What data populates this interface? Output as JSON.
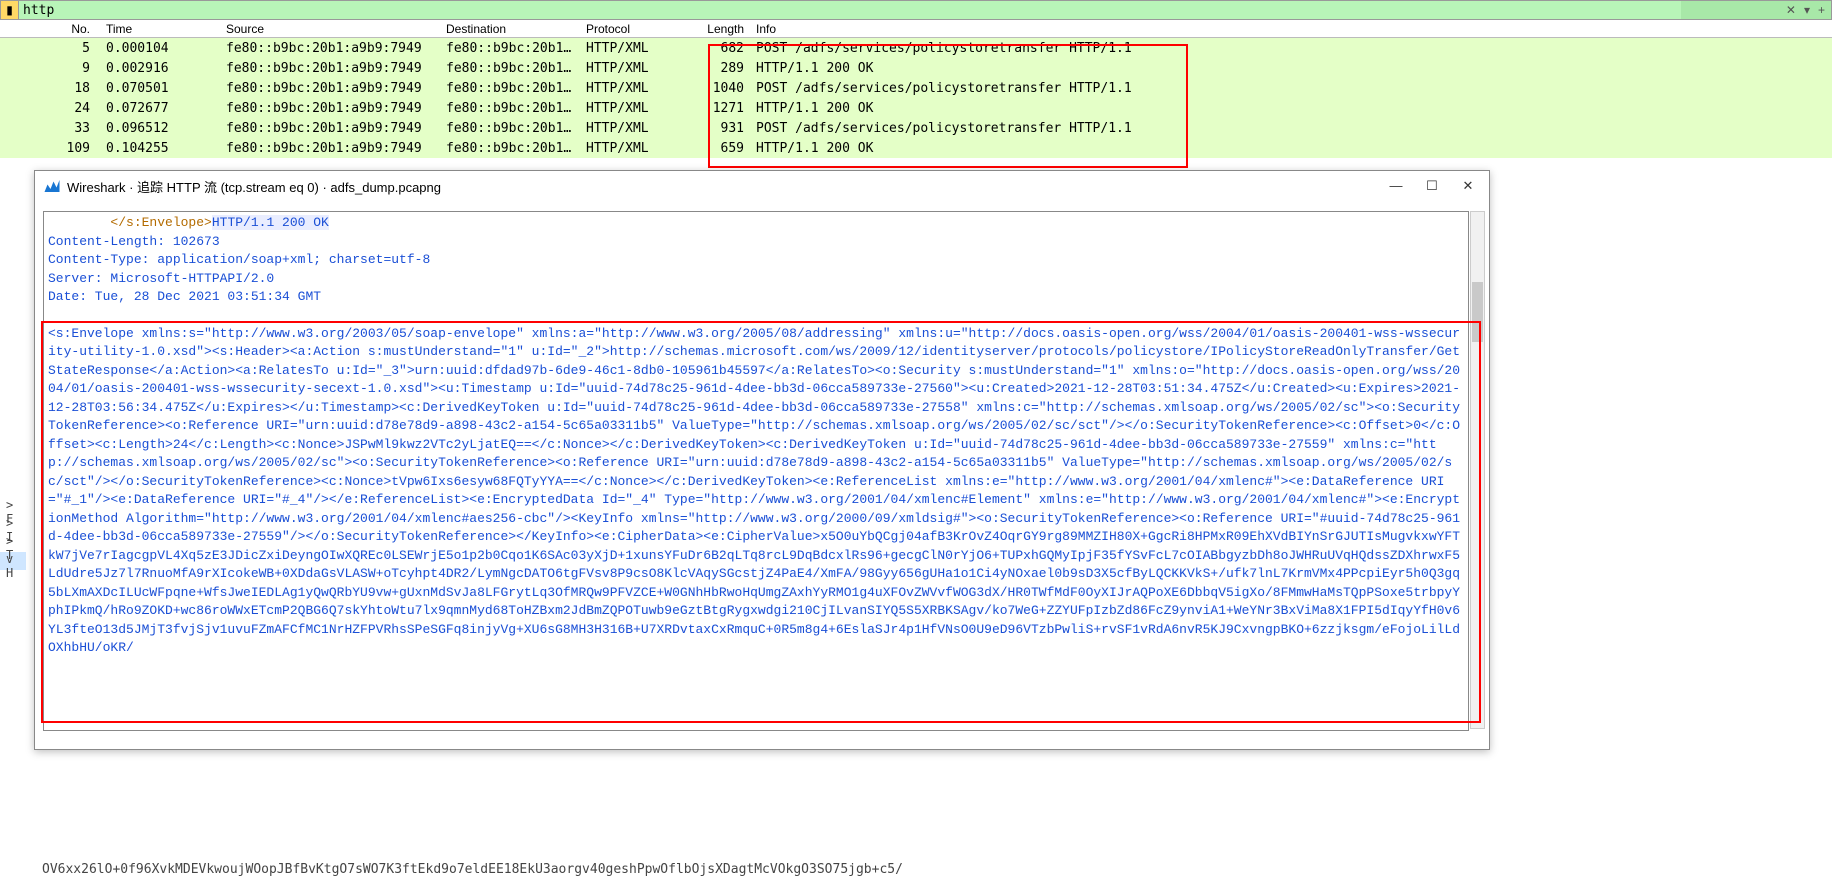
{
  "filter": {
    "value": "http"
  },
  "columns": {
    "no": "No.",
    "time": "Time",
    "src": "Source",
    "dst": "Destination",
    "proto": "Protocol",
    "len": "Length",
    "info": "Info"
  },
  "packets": [
    {
      "no": "5",
      "time": "0.000104",
      "src": "fe80::b9bc:20b1:a9b9:7949",
      "dst": "fe80::b9bc:20b1…",
      "proto": "HTTP/XML",
      "len": "682",
      "info": "POST /adfs/services/policystoretransfer HTTP/1.1"
    },
    {
      "no": "9",
      "time": "0.002916",
      "src": "fe80::b9bc:20b1:a9b9:7949",
      "dst": "fe80::b9bc:20b1…",
      "proto": "HTTP/XML",
      "len": "289",
      "info": "HTTP/1.1 200 OK"
    },
    {
      "no": "18",
      "time": "0.070501",
      "src": "fe80::b9bc:20b1:a9b9:7949",
      "dst": "fe80::b9bc:20b1…",
      "proto": "HTTP/XML",
      "len": "1040",
      "info": "POST /adfs/services/policystoretransfer HTTP/1.1"
    },
    {
      "no": "24",
      "time": "0.072677",
      "src": "fe80::b9bc:20b1:a9b9:7949",
      "dst": "fe80::b9bc:20b1…",
      "proto": "HTTP/XML",
      "len": "1271",
      "info": "HTTP/1.1 200 OK"
    },
    {
      "no": "33",
      "time": "0.096512",
      "src": "fe80::b9bc:20b1:a9b9:7949",
      "dst": "fe80::b9bc:20b1…",
      "proto": "HTTP/XML",
      "len": "931",
      "info": "POST /adfs/services/policystoretransfer HTTP/1.1"
    },
    {
      "no": "109",
      "time": "0.104255",
      "src": "fe80::b9bc:20b1:a9b9:7949",
      "dst": "fe80::b9bc:20b1…",
      "proto": "HTTP/XML",
      "len": "659",
      "info": "HTTP/1.1 200 OK"
    }
  ],
  "stream_window": {
    "title": "Wireshark · 追踪 HTTP 流 (tcp.stream eq 0) · adfs_dump.pcapng",
    "close_tag": "</s:Envelope>",
    "status_line": "HTTP/1.1 200 OK",
    "headers": [
      "Content-Length: 102673",
      "Content-Type: application/soap+xml; charset=utf-8",
      "Server: Microsoft-HTTPAPI/2.0",
      "Date: Tue, 28 Dec 2021 03:51:34 GMT"
    ],
    "soap_body": "<s:Envelope xmlns:s=\"http://www.w3.org/2003/05/soap-envelope\" xmlns:a=\"http://www.w3.org/2005/08/addressing\" xmlns:u=\"http://docs.oasis-open.org/wss/2004/01/oasis-200401-wss-wssecurity-utility-1.0.xsd\"><s:Header><a:Action s:mustUnderstand=\"1\" u:Id=\"_2\">http://schemas.microsoft.com/ws/2009/12/identityserver/protocols/policystore/IPolicyStoreReadOnlyTransfer/GetStateResponse</a:Action><a:RelatesTo u:Id=\"_3\">urn:uuid:dfdad97b-6de9-46c1-8db0-105961b45597</a:RelatesTo><o:Security s:mustUnderstand=\"1\" xmlns:o=\"http://docs.oasis-open.org/wss/2004/01/oasis-200401-wss-wssecurity-secext-1.0.xsd\"><u:Timestamp u:Id=\"uuid-74d78c25-961d-4dee-bb3d-06cca589733e-27560\"><u:Created>2021-12-28T03:51:34.475Z</u:Created><u:Expires>2021-12-28T03:56:34.475Z</u:Expires></u:Timestamp><c:DerivedKeyToken u:Id=\"uuid-74d78c25-961d-4dee-bb3d-06cca589733e-27558\" xmlns:c=\"http://schemas.xmlsoap.org/ws/2005/02/sc\"><o:SecurityTokenReference><o:Reference URI=\"urn:uuid:d78e78d9-a898-43c2-a154-5c65a03311b5\" ValueType=\"http://schemas.xmlsoap.org/ws/2005/02/sc/sct\"/></o:SecurityTokenReference><c:Offset>0</c:Offset><c:Length>24</c:Length><c:Nonce>JSPwMl9kwz2VTc2yLjatEQ==</c:Nonce></c:DerivedKeyToken><c:DerivedKeyToken u:Id=\"uuid-74d78c25-961d-4dee-bb3d-06cca589733e-27559\" xmlns:c=\"http://schemas.xmlsoap.org/ws/2005/02/sc\"><o:SecurityTokenReference><o:Reference URI=\"urn:uuid:d78e78d9-a898-43c2-a154-5c65a03311b5\" ValueType=\"http://schemas.xmlsoap.org/ws/2005/02/sc/sct\"/></o:SecurityTokenReference><c:Nonce>tVpw6Ixs6esyw68FQTyYYA==</c:Nonce></c:DerivedKeyToken><e:ReferenceList xmlns:e=\"http://www.w3.org/2001/04/xmlenc#\"><e:DataReference URI=\"#_1\"/><e:DataReference URI=\"#_4\"/></e:ReferenceList><e:EncryptedData Id=\"_4\" Type=\"http://www.w3.org/2001/04/xmlenc#Element\" xmlns:e=\"http://www.w3.org/2001/04/xmlenc#\"><e:EncryptionMethod Algorithm=\"http://www.w3.org/2001/04/xmlenc#aes256-cbc\"/><KeyInfo xmlns=\"http://www.w3.org/2000/09/xmldsig#\"><o:SecurityTokenReference><o:Reference URI=\"#uuid-74d78c25-961d-4dee-bb3d-06cca589733e-27559\"/></o:SecurityTokenReference></KeyInfo><e:CipherData><e:CipherValue>x5O0uYbQCgj04afB3KrOvZ4OqrGY9rg89MMZIH80X+GgcRi8HPMxR09EhXVdBIYnSrGJUTIsMugvkxwYFTkW7jVe7rIagcgpVL4Xq5zE3JDicZxiDeyngOIwXQREc0LSEWrjE5o1p2b0Cqo1K6SAc03yXjD+1xunsYFuDr6B2qLTq8rcL9DqBdcxlRs96+gecgClN0rYjO6+TUPxhGQMyIpjF35fYSvFcL7cOIABbgyzbDh8oJWHRuUVqHQdssZDXhrwxF5LdUdre5Jz7l7RnuoMfA9rXIcokeWB+0XDdaGsVLASW+oTcyhpt4DR2/LymNgcDATO6tgFVsv8P9csO8KlcVAqySGcstjZ4PaE4/XmFA/98Gyy656gUHa1o1Ci4yNOxael0b9sD3X5cfByLQCKKVkS+/ufk7lnL7KrmVMx4PPcpiEyr5h0Q3gq5bLXmAXDcILUcWFpqne+WfsJweIEDLAg1yQwQRbYU9vw+gUxnMdSvJa8LFGrytLq3OfMRQw9PFVZCE+W0GNhHbRwoHqUmgZAxhYyRMO1g4uXFOvZWVvfWOG3dX/HR0TWfMdF0OyXIJrAQPoXE6DbbqV5igXo/8FMmwHaMsTQpPSoxe5trbpyYphIPkmQ/hRo9ZOKD+wc86roWWxETcmP2QBG6Q7skYhtoWtu7lx9qmnMyd68ToHZBxm2JdBmZQPOTuwb9eGztBtgRygxwdgi210CjILvanSIYQ5S5XRBKSAgv/ko7WeG+ZZYUFpIzbZd86FcZ9ynviA1+WeYNr3BxViMa8X1FPI5dIqyYfH0v6YL3fteO13d5JMjT3fvjSjv1uvuFZmAFCfMC1NrHZFPVRhsSPeSGFq8injyVg+XU6sG8MH3H316B+U7XRDvtaxCxRmquC+0R5m8g4+6EslaSJr4p1HfVNsO0U9eD96VTzbPwliS+rvSF1vRdA6nvR5KJ9CxvngpBKO+6zzjksgm/eFojoLilLdOXhbHU/oKR/"
  },
  "left_sliver": [
    "> F",
    "> I",
    "> T",
    "v H"
  ],
  "bottom_clip": "OV6xx26lO+0f96XvkMDEVkwoujWOopJBfBvKtgO7sWO7K3ftEkd9o7eldEE18EkU3aorgv40geshPpwOflbOjsXDagtMcVOkgO3SO75jgb+c5/"
}
